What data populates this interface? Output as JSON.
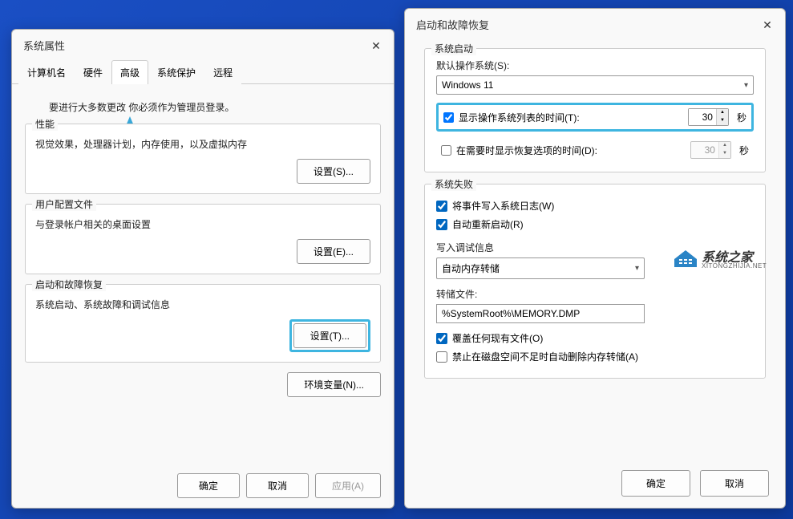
{
  "dialog1": {
    "title": "系统属性",
    "tabs": [
      "计算机名",
      "硬件",
      "高级",
      "系统保护",
      "远程"
    ],
    "active_tab_index": 2,
    "admin_note_left": "要进行大多数更改",
    "admin_note_right": "你必须作为管理员登录。",
    "groups": {
      "performance": {
        "title": "性能",
        "desc": "视觉效果，处理器计划，内存使用，以及虚拟内存",
        "btn": "设置(S)..."
      },
      "userprofile": {
        "title": "用户配置文件",
        "desc": "与登录帐户相关的桌面设置",
        "btn": "设置(E)..."
      },
      "startup": {
        "title": "启动和故障恢复",
        "desc": "系统启动、系统故障和调试信息",
        "btn": "设置(T)..."
      }
    },
    "env_btn": "环境变量(N)...",
    "footer": {
      "ok": "确定",
      "cancel": "取消",
      "apply": "应用(A)"
    }
  },
  "dialog2": {
    "title": "启动和故障恢复",
    "sections": {
      "startup": {
        "title": "系统启动",
        "default_os_label": "默认操作系统(S):",
        "default_os_value": "Windows 11",
        "show_list": {
          "label": "显示操作系统列表的时间(T):",
          "value": "30",
          "unit": "秒",
          "checked": true
        },
        "show_recovery": {
          "label": "在需要时显示恢复选项的时间(D):",
          "value": "30",
          "unit": "秒",
          "checked": false
        }
      },
      "failure": {
        "title": "系统失败",
        "write_event": {
          "label": "将事件写入系统日志(W)",
          "checked": true
        },
        "auto_restart": {
          "label": "自动重新启动(R)",
          "checked": true
        },
        "debug_label": "写入调试信息",
        "debug_value": "自动内存转储",
        "dump_label": "转储文件:",
        "dump_value": "%SystemRoot%\\MEMORY.DMP",
        "overwrite": {
          "label": "覆盖任何现有文件(O)",
          "checked": true
        },
        "disable_lowdisk": {
          "label": "禁止在磁盘空间不足时自动删除内存转储(A)",
          "checked": false
        }
      }
    },
    "footer": {
      "ok": "确定",
      "cancel": "取消"
    }
  },
  "watermark": {
    "text": "系统之家",
    "sub": "XITONGZHIJIA.NET"
  }
}
